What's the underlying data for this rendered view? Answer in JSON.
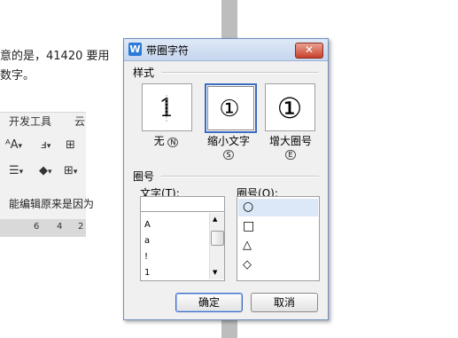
{
  "background": {
    "line1": "意的是，41420 要用",
    "line2": "数字。",
    "tab_dev": "开发工具",
    "tab_cloud": "云",
    "status_text": "能编辑原来是因为",
    "ruler_ticks": [
      "6",
      "4",
      "2"
    ]
  },
  "dialog": {
    "title": "带圈字符",
    "close_label": "✕",
    "style_group": "样式",
    "styles": [
      {
        "glyph": "1",
        "label": "无",
        "key": "N",
        "selected": false
      },
      {
        "glyph": "①",
        "label": "缩小文字",
        "key": "S",
        "selected": true
      },
      {
        "glyph": "①",
        "label": "增大圈号",
        "key": "E",
        "selected": false
      }
    ],
    "circle_group": "圈号",
    "text_label": "文字",
    "text_key": "T",
    "ring_label": "圈号",
    "ring_key": "O",
    "text_value": "",
    "text_list": [
      "A",
      "a",
      "!",
      "1"
    ],
    "ring_list": [
      "○",
      "□",
      "△",
      "◇"
    ],
    "ok_label": "确定",
    "cancel_label": "取消"
  }
}
